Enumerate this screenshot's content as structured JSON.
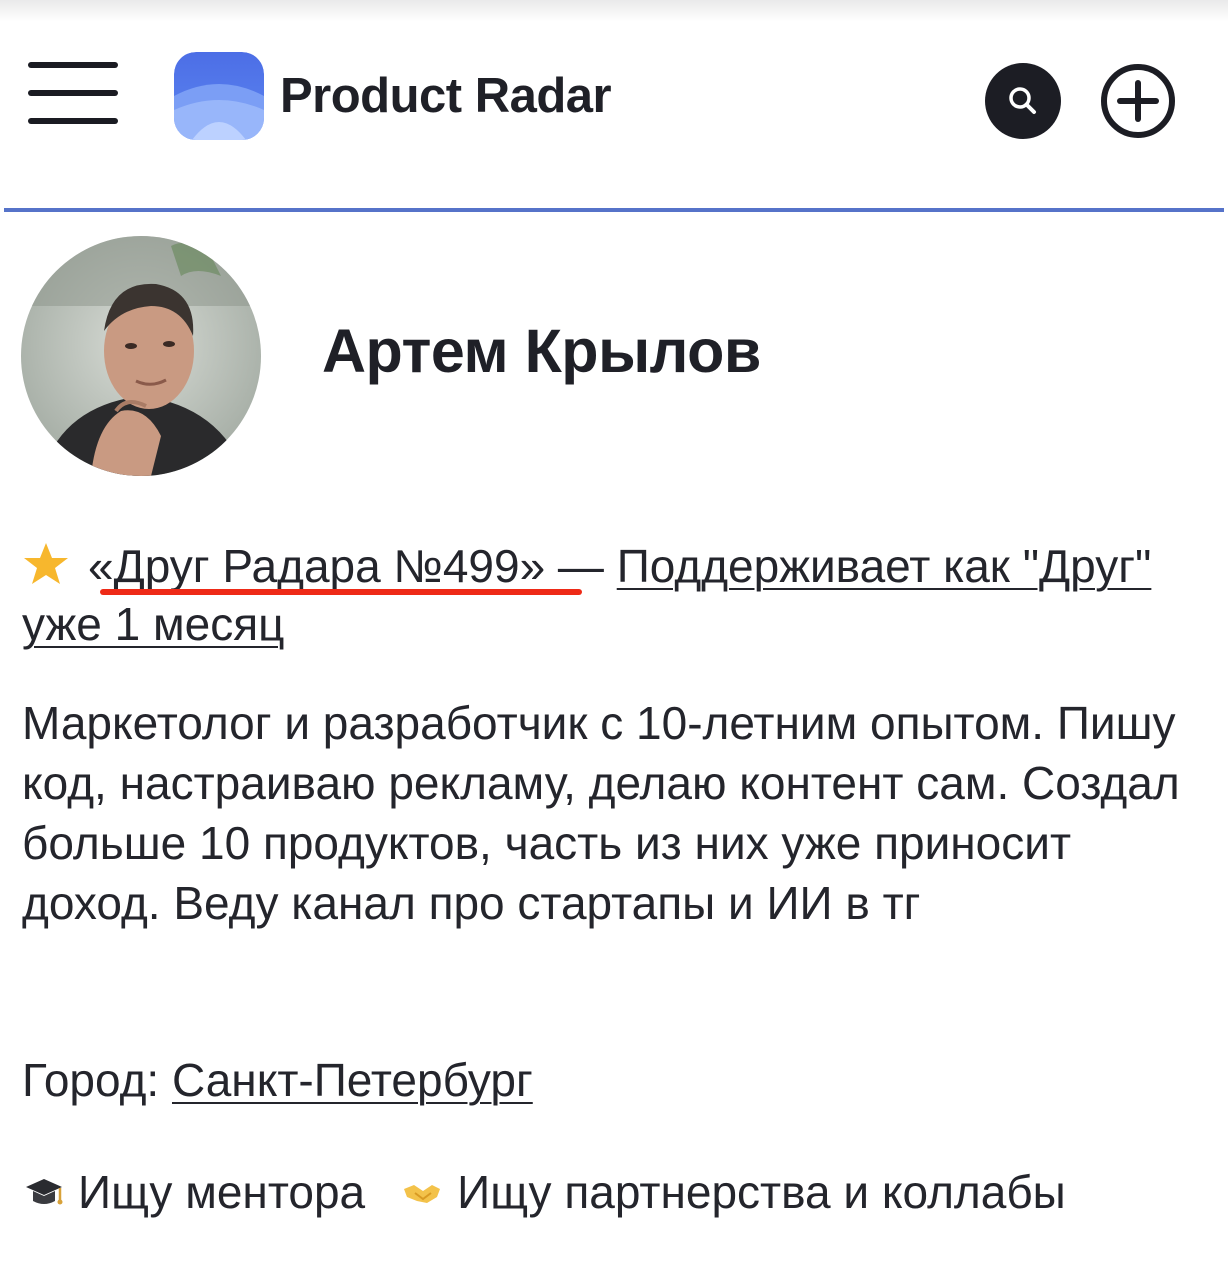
{
  "header": {
    "app_name": "Product Radar",
    "menu_icon": "hamburger-menu-icon",
    "search_icon": "search-icon",
    "add_icon": "plus-circle-icon",
    "accent_color": "#5673c9"
  },
  "profile": {
    "name": "Артем Крылов",
    "badge": {
      "icon": "star-icon",
      "title": "«Друг Радара №499»",
      "separator": " — ",
      "support_text": "Поддерживает как \"Друг\" уже 1 месяц"
    },
    "bio": "Маркетолог и разработчик с 10-летним опытом. Пишу код, настраиваю рекламу, делаю контент сам. Создал больше 10 продуктов, часть из них уже приносит доход. Веду канал про стартапы и ИИ в тг",
    "city_label": "Город:",
    "city": "Санкт-Петербург",
    "tags": [
      {
        "icon": "graduation-cap-icon",
        "label": "Ищу ментора"
      },
      {
        "icon": "handshake-icon",
        "label": "Ищу партнерства и коллабы"
      }
    ]
  }
}
